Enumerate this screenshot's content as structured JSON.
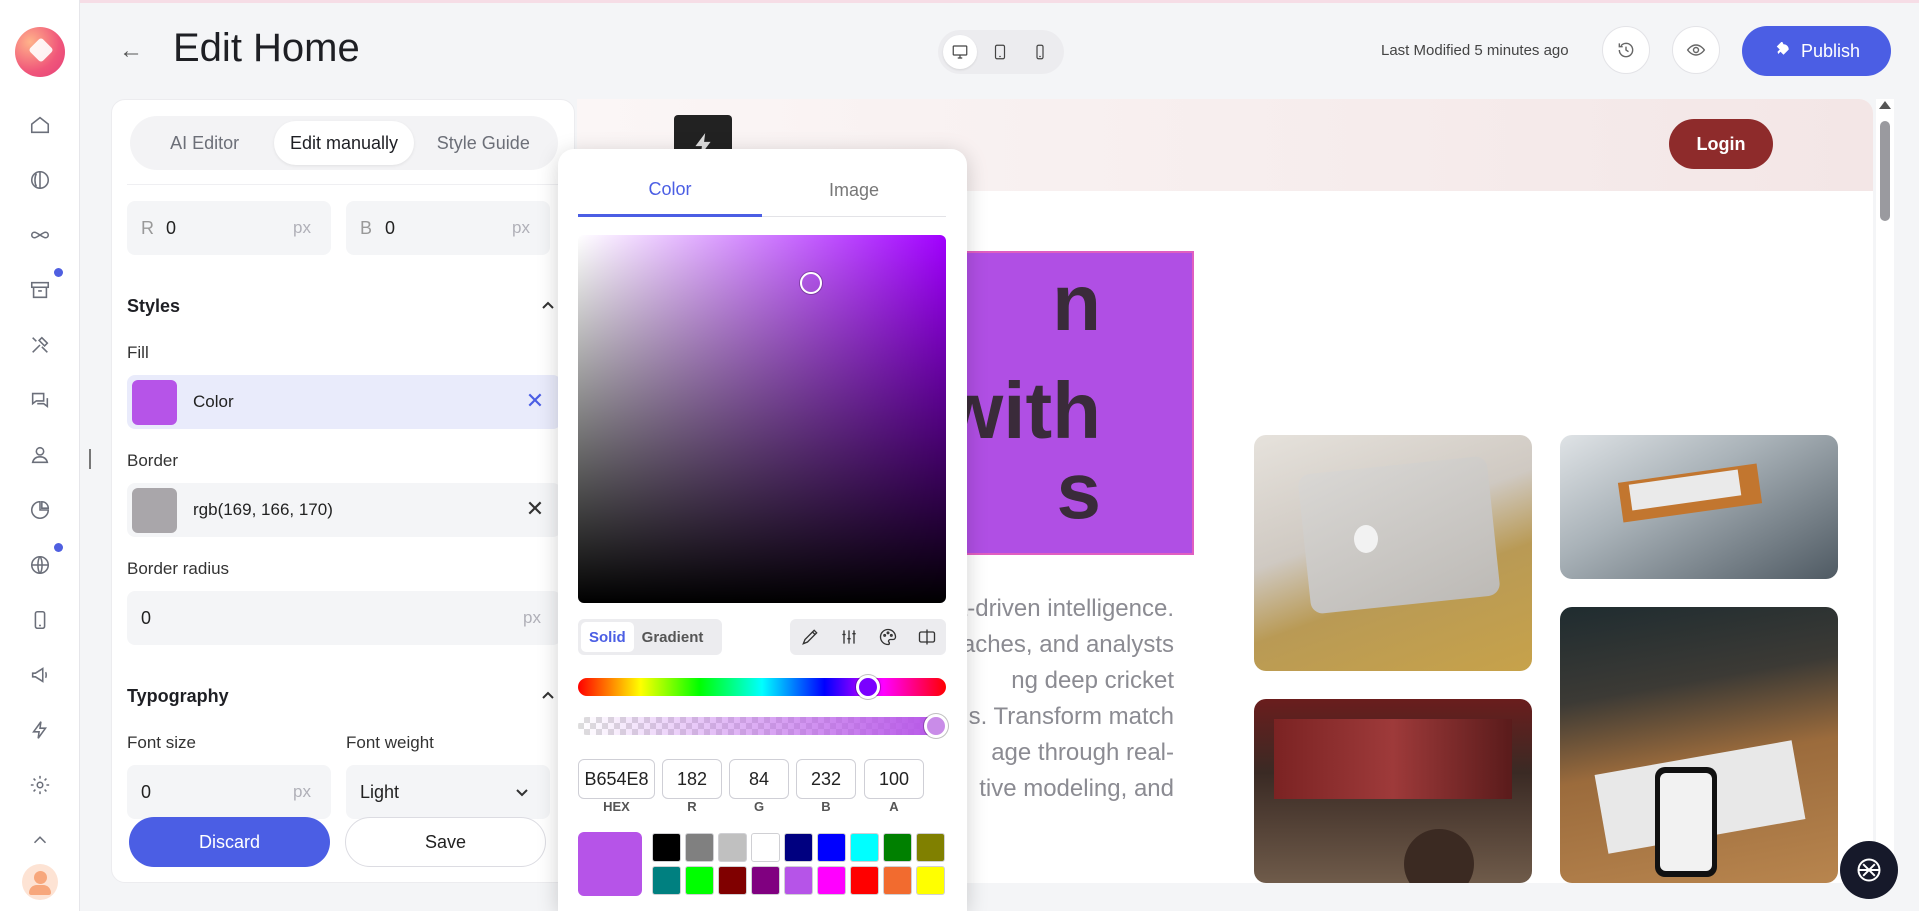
{
  "header": {
    "title": "Edit Home",
    "last_modified": "Last Modified 5 minutes ago",
    "publish_label": "Publish"
  },
  "panel": {
    "tabs": [
      {
        "label": "AI Editor"
      },
      {
        "label": "Edit manually"
      },
      {
        "label": "Style Guide"
      }
    ],
    "spacing": {
      "r_prefix": "R",
      "r_value": "0",
      "b_prefix": "B",
      "b_value": "0",
      "unit": "px"
    },
    "styles": {
      "heading": "Styles",
      "fill_label": "Fill",
      "fill_value": "Color",
      "fill_color": "#b654e8",
      "border_label": "Border",
      "border_value": "rgb(169, 166, 170)",
      "border_color": "#a9a6aa",
      "radius_label": "Border radius",
      "radius_value": "0",
      "unit": "px"
    },
    "typography": {
      "heading": "Typography",
      "size_label": "Font size",
      "size_value": "0",
      "unit": "px",
      "weight_label": "Font weight",
      "weight_value": "Light"
    },
    "discard_label": "Discard",
    "save_label": "Save"
  },
  "picker": {
    "tabs": [
      {
        "label": "Color"
      },
      {
        "label": "Image"
      }
    ],
    "modes": [
      {
        "label": "Solid"
      },
      {
        "label": "Gradient"
      }
    ],
    "hex": "B654E8",
    "r": "182",
    "g": "84",
    "b": "232",
    "a": "100",
    "labels": {
      "hex": "HEX",
      "r": "R",
      "g": "G",
      "b": "B",
      "a": "A"
    },
    "current_color": "#b654e8",
    "presets": [
      "#000000",
      "#808080",
      "#c0c0c0",
      "#ffffff",
      "#000080",
      "#0000ff",
      "#00ffff",
      "#008000",
      "#808000",
      "#008080",
      "#00ff00",
      "#800000",
      "#800080",
      "#b654e8",
      "#ff00ff",
      "#ff0000",
      "#f26b2f",
      "#ffff00"
    ]
  },
  "preview": {
    "login_label": "Login",
    "hero_lines": [
      "n",
      "with",
      "s"
    ],
    "paragraph": [
      "a-driven intelligence.",
      "oaches, and analysts",
      "ng deep cricket",
      "s. Transform match",
      "age through real-",
      "tive modeling, and"
    ]
  }
}
